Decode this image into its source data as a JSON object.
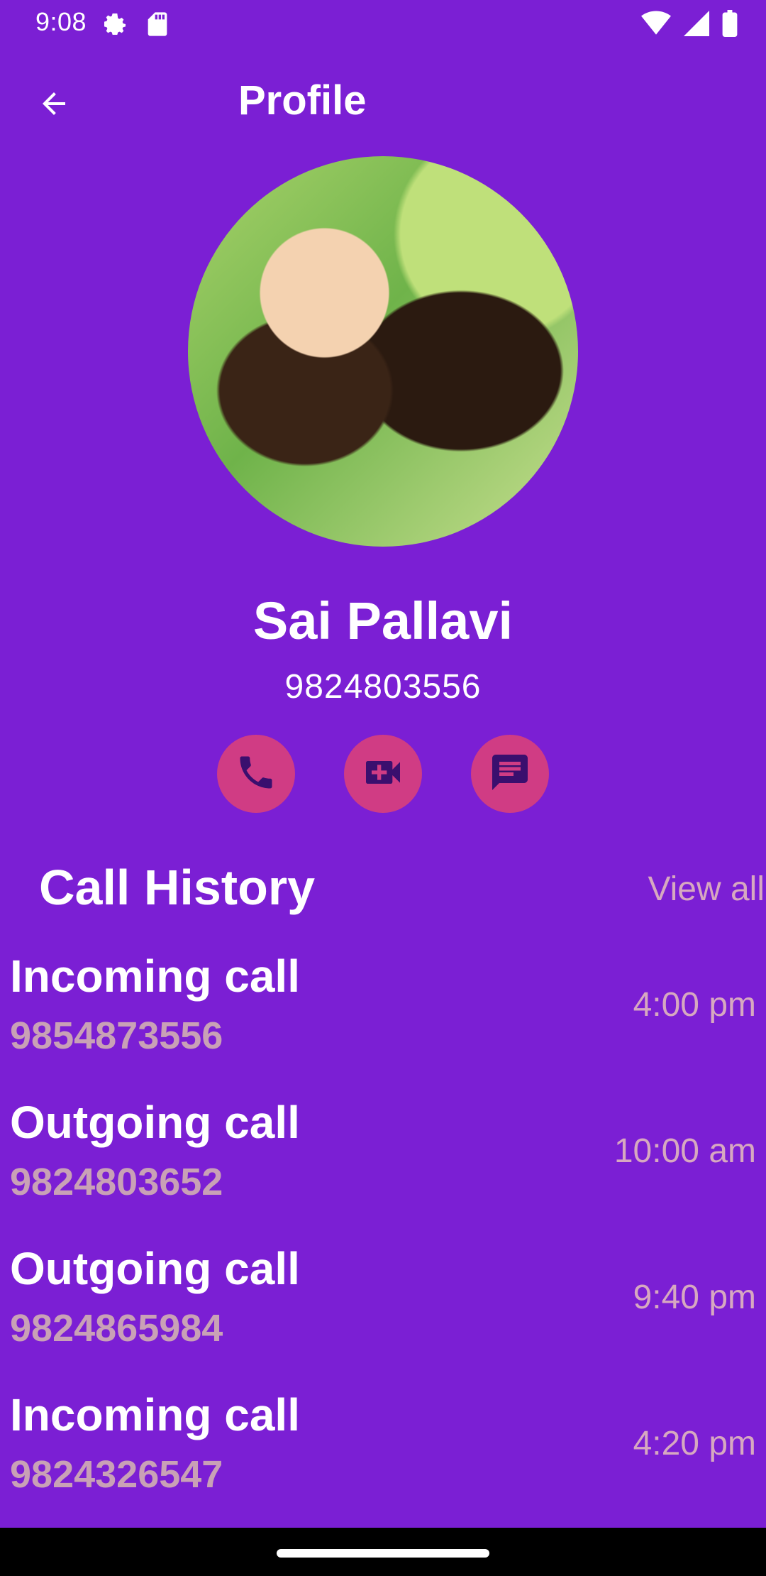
{
  "status_bar": {
    "time": "9:08",
    "icons_left": [
      "settings-icon",
      "sd-card-icon"
    ],
    "icons_right": [
      "wifi-icon",
      "signal-icon",
      "battery-icon"
    ]
  },
  "app_bar": {
    "title": "Profile",
    "back_icon": "arrow-back-icon"
  },
  "profile": {
    "name": "Sai Pallavi",
    "number": "9824803556"
  },
  "actions": [
    {
      "icon": "phone-icon"
    },
    {
      "icon": "video-call-icon"
    },
    {
      "icon": "message-icon"
    }
  ],
  "call_history": {
    "title": "Call History",
    "view_all": "View all",
    "items": [
      {
        "type": "Incoming call",
        "number": "9854873556",
        "time": "4:00 pm"
      },
      {
        "type": "Outgoing call",
        "number": "9824803652",
        "time": "10:00 am"
      },
      {
        "type": "Outgoing call",
        "number": "9824865984",
        "time": "9:40 pm"
      },
      {
        "type": "Incoming call",
        "number": "9824326547",
        "time": "4:20 pm"
      }
    ]
  },
  "colors": {
    "background": "#7b1fd4",
    "action_button": "#d03c84",
    "action_icon": "#3a0f6e",
    "muted_text": "#c9a1b6"
  }
}
